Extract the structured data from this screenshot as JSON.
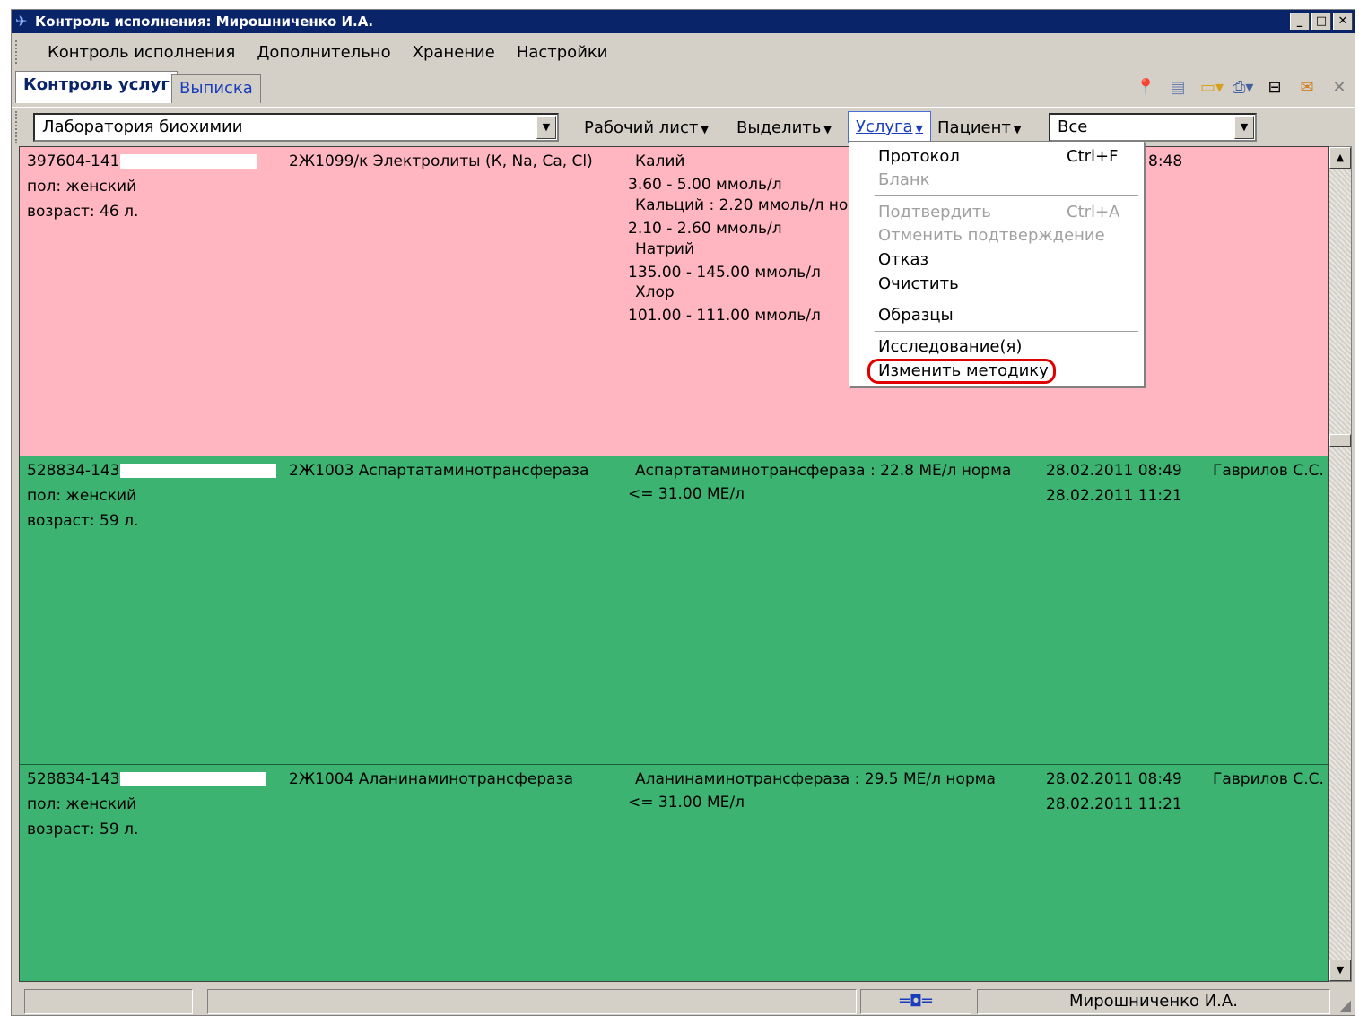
{
  "window": {
    "title": "Контроль исполнения: Мирошниченко И.А.",
    "min": "_",
    "max": "□",
    "close": "✕"
  },
  "menubar": {
    "items": [
      "Контроль исполнения",
      "Дополнительно",
      "Хранение",
      "Настройки"
    ]
  },
  "tabs": {
    "active": "Контроль услуг",
    "second": "Выписка"
  },
  "toolbar": {
    "lab_combo": "Лаборатория биохимии",
    "worksheet": "Рабочий лист",
    "select": "Выделить",
    "service": "Услуга",
    "patient": "Пациент",
    "filter_combo": "Все"
  },
  "icons": [
    "pin-icon",
    "document-icon",
    "folder-icon",
    "print-icon",
    "window-icon",
    "mail-icon",
    "close-icon"
  ],
  "rows": [
    {
      "id": "397604-141",
      "sex": "пол: женский",
      "age": "возраст: 46 л.",
      "service": "2Ж1099/к Электролиты (К, Na, Ca, Cl)",
      "results": [
        "Калий",
        "3.60 - 5.00 ммоль/л",
        "Кальций : 2.20 ммоль/л нор",
        "2.10 - 2.60 ммоль/л",
        "Натрий",
        "135.00 - 145.00 ммоль/л",
        "Хлор",
        "101.00 - 111.00 ммоль/л"
      ],
      "date1": "8:48",
      "date2": "",
      "doctor": ""
    },
    {
      "id": "528834-143",
      "sex": "пол: женский",
      "age": "возраст: 59 л.",
      "service": "2Ж1003 Аспартатаминотрансфераза",
      "result_line1": "Аспартатаминотрансфераза : 22.8 МЕ/л норма",
      "result_line2": "<= 31.00 МЕ/л",
      "date1": "28.02.2011 08:49",
      "date2": "28.02.2011 11:21",
      "doctor": "Гаврилов С.С."
    },
    {
      "id": "528834-143",
      "sex": "пол: женский",
      "age": "возраст: 59 л.",
      "service": "2Ж1004 Аланинаминотрансфераза",
      "result_line1": "Аланинаминотрансфераза : 29.5 МЕ/л норма",
      "result_line2": "<= 31.00 МЕ/л",
      "date1": "28.02.2011 08:49",
      "date2": "28.02.2011 11:21",
      "doctor": "Гаврилов С.С."
    }
  ],
  "popup": {
    "protocol": "Протокол",
    "protocol_sc": "Ctrl+F",
    "blank": "Бланк",
    "confirm": "Подтвердить",
    "confirm_sc": "Ctrl+A",
    "cancel_confirm": "Отменить подтверждение",
    "refuse": "Отказ",
    "clear": "Очистить",
    "samples": "Образцы",
    "research": "Исследование(я)",
    "change_method": "Изменить методику"
  },
  "status": {
    "user": "Мирошниченко И.А."
  },
  "colors": {
    "pink_row": "#ffb6c1",
    "green_row": "#3cb371",
    "titlebar": "#0a246a",
    "highlight": "#e00000"
  }
}
